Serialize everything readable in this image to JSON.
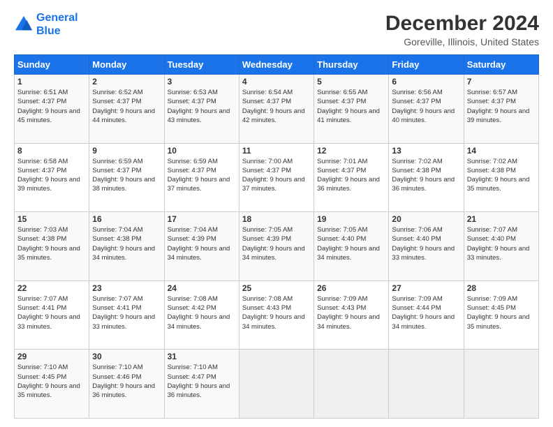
{
  "logo": {
    "line1": "General",
    "line2": "Blue"
  },
  "title": "December 2024",
  "subtitle": "Goreville, Illinois, United States",
  "days_of_week": [
    "Sunday",
    "Monday",
    "Tuesday",
    "Wednesday",
    "Thursday",
    "Friday",
    "Saturday"
  ],
  "weeks": [
    [
      {
        "day": "1",
        "sunrise": "6:51 AM",
        "sunset": "4:37 PM",
        "daylight": "9 hours and 45 minutes."
      },
      {
        "day": "2",
        "sunrise": "6:52 AM",
        "sunset": "4:37 PM",
        "daylight": "9 hours and 44 minutes."
      },
      {
        "day": "3",
        "sunrise": "6:53 AM",
        "sunset": "4:37 PM",
        "daylight": "9 hours and 43 minutes."
      },
      {
        "day": "4",
        "sunrise": "6:54 AM",
        "sunset": "4:37 PM",
        "daylight": "9 hours and 42 minutes."
      },
      {
        "day": "5",
        "sunrise": "6:55 AM",
        "sunset": "4:37 PM",
        "daylight": "9 hours and 41 minutes."
      },
      {
        "day": "6",
        "sunrise": "6:56 AM",
        "sunset": "4:37 PM",
        "daylight": "9 hours and 40 minutes."
      },
      {
        "day": "7",
        "sunrise": "6:57 AM",
        "sunset": "4:37 PM",
        "daylight": "9 hours and 39 minutes."
      }
    ],
    [
      {
        "day": "8",
        "sunrise": "6:58 AM",
        "sunset": "4:37 PM",
        "daylight": "9 hours and 39 minutes."
      },
      {
        "day": "9",
        "sunrise": "6:59 AM",
        "sunset": "4:37 PM",
        "daylight": "9 hours and 38 minutes."
      },
      {
        "day": "10",
        "sunrise": "6:59 AM",
        "sunset": "4:37 PM",
        "daylight": "9 hours and 37 minutes."
      },
      {
        "day": "11",
        "sunrise": "7:00 AM",
        "sunset": "4:37 PM",
        "daylight": "9 hours and 37 minutes."
      },
      {
        "day": "12",
        "sunrise": "7:01 AM",
        "sunset": "4:37 PM",
        "daylight": "9 hours and 36 minutes."
      },
      {
        "day": "13",
        "sunrise": "7:02 AM",
        "sunset": "4:38 PM",
        "daylight": "9 hours and 36 minutes."
      },
      {
        "day": "14",
        "sunrise": "7:02 AM",
        "sunset": "4:38 PM",
        "daylight": "9 hours and 35 minutes."
      }
    ],
    [
      {
        "day": "15",
        "sunrise": "7:03 AM",
        "sunset": "4:38 PM",
        "daylight": "9 hours and 35 minutes."
      },
      {
        "day": "16",
        "sunrise": "7:04 AM",
        "sunset": "4:38 PM",
        "daylight": "9 hours and 34 minutes."
      },
      {
        "day": "17",
        "sunrise": "7:04 AM",
        "sunset": "4:39 PM",
        "daylight": "9 hours and 34 minutes."
      },
      {
        "day": "18",
        "sunrise": "7:05 AM",
        "sunset": "4:39 PM",
        "daylight": "9 hours and 34 minutes."
      },
      {
        "day": "19",
        "sunrise": "7:05 AM",
        "sunset": "4:40 PM",
        "daylight": "9 hours and 34 minutes."
      },
      {
        "day": "20",
        "sunrise": "7:06 AM",
        "sunset": "4:40 PM",
        "daylight": "9 hours and 33 minutes."
      },
      {
        "day": "21",
        "sunrise": "7:07 AM",
        "sunset": "4:40 PM",
        "daylight": "9 hours and 33 minutes."
      }
    ],
    [
      {
        "day": "22",
        "sunrise": "7:07 AM",
        "sunset": "4:41 PM",
        "daylight": "9 hours and 33 minutes."
      },
      {
        "day": "23",
        "sunrise": "7:07 AM",
        "sunset": "4:41 PM",
        "daylight": "9 hours and 33 minutes."
      },
      {
        "day": "24",
        "sunrise": "7:08 AM",
        "sunset": "4:42 PM",
        "daylight": "9 hours and 34 minutes."
      },
      {
        "day": "25",
        "sunrise": "7:08 AM",
        "sunset": "4:43 PM",
        "daylight": "9 hours and 34 minutes."
      },
      {
        "day": "26",
        "sunrise": "7:09 AM",
        "sunset": "4:43 PM",
        "daylight": "9 hours and 34 minutes."
      },
      {
        "day": "27",
        "sunrise": "7:09 AM",
        "sunset": "4:44 PM",
        "daylight": "9 hours and 34 minutes."
      },
      {
        "day": "28",
        "sunrise": "7:09 AM",
        "sunset": "4:45 PM",
        "daylight": "9 hours and 35 minutes."
      }
    ],
    [
      {
        "day": "29",
        "sunrise": "7:10 AM",
        "sunset": "4:45 PM",
        "daylight": "9 hours and 35 minutes."
      },
      {
        "day": "30",
        "sunrise": "7:10 AM",
        "sunset": "4:46 PM",
        "daylight": "9 hours and 36 minutes."
      },
      {
        "day": "31",
        "sunrise": "7:10 AM",
        "sunset": "4:47 PM",
        "daylight": "9 hours and 36 minutes."
      },
      null,
      null,
      null,
      null
    ]
  ]
}
